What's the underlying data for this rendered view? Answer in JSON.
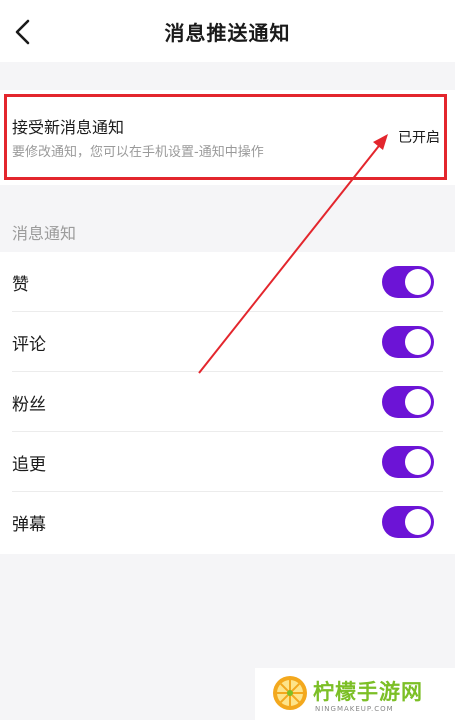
{
  "header": {
    "title": "消息推送通知",
    "back_icon": "chevron-left-icon"
  },
  "main_setting": {
    "title": "接受新消息通知",
    "subtitle": "要修改通知，您可以在手机设置-通知中操作",
    "status": "已开启",
    "highlight_color": "#e3262d"
  },
  "section": {
    "label": "消息通知"
  },
  "items": [
    {
      "label": "赞",
      "enabled": true
    },
    {
      "label": "评论",
      "enabled": true
    },
    {
      "label": "粉丝",
      "enabled": true
    },
    {
      "label": "追更",
      "enabled": true
    },
    {
      "label": "弹幕",
      "enabled": true
    }
  ],
  "colors": {
    "toggle_on": "#6c14d6",
    "annotation_red": "#e3262d",
    "watermark_green": "#7cbf26"
  },
  "watermark": {
    "brand": "柠檬手游网",
    "url": "NINGMAKEUP.COM"
  }
}
